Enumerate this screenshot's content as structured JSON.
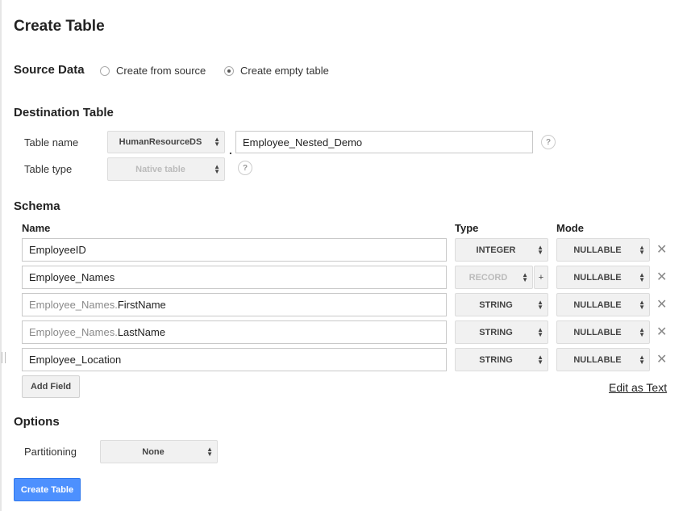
{
  "page_title": "Create Table",
  "source_data": {
    "label": "Source Data",
    "options": [
      {
        "label": "Create from source",
        "selected": false
      },
      {
        "label": "Create empty table",
        "selected": true
      }
    ]
  },
  "destination_table": {
    "label": "Destination Table",
    "table_name_label": "Table name",
    "dataset_value": "HumanResourceDS",
    "separator": ".",
    "table_name_value": "Employee_Nested_Demo",
    "table_type_label": "Table type",
    "table_type_value": "Native table",
    "help_glyph": "?"
  },
  "schema": {
    "label": "Schema",
    "headers": {
      "name": "Name",
      "type": "Type",
      "mode": "Mode"
    },
    "rows": [
      {
        "prefix": "",
        "name": "EmployeeID",
        "type": "INTEGER",
        "mode": "NULLABLE",
        "type_disabled": false,
        "has_plus": false
      },
      {
        "prefix": "",
        "name": "Employee_Names",
        "type": "RECORD",
        "mode": "NULLABLE",
        "type_disabled": true,
        "has_plus": true
      },
      {
        "prefix": "Employee_Names.",
        "name": "FirstName",
        "type": "STRING",
        "mode": "NULLABLE",
        "type_disabled": false,
        "has_plus": false
      },
      {
        "prefix": "Employee_Names.",
        "name": "LastName",
        "type": "STRING",
        "mode": "NULLABLE",
        "type_disabled": false,
        "has_plus": false
      },
      {
        "prefix": "",
        "name": "Employee_Location",
        "type": "STRING",
        "mode": "NULLABLE",
        "type_disabled": false,
        "has_plus": false
      }
    ],
    "plus_glyph": "+",
    "remove_glyph": "✕",
    "add_field_label": "Add Field",
    "edit_as_text_label": "Edit as Text"
  },
  "options": {
    "label": "Options",
    "partitioning_label": "Partitioning",
    "partitioning_value": "None"
  },
  "create_button_label": "Create Table",
  "colors": {
    "primary_button": "#4d90fe",
    "select_bg": "#f1f1f1",
    "input_border": "#c9c9c9"
  }
}
